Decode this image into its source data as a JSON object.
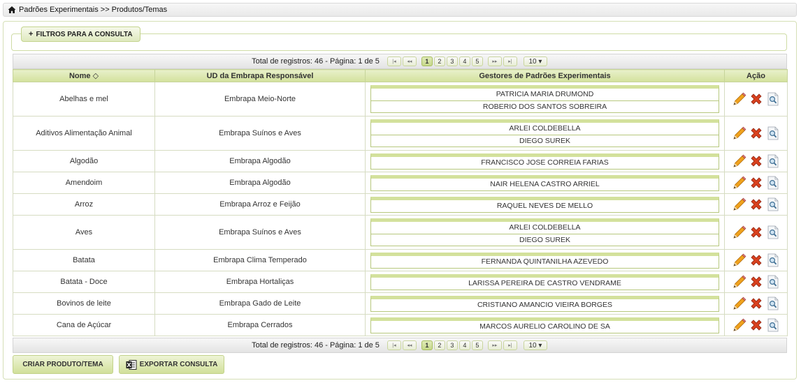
{
  "breadcrumb": {
    "home_icon": "home-icon",
    "text": "Padrões Experimentais >> Produtos/Temas"
  },
  "filters": {
    "toggle_label": "FILTROS PARA A CONSULTA",
    "toggle_symbol": "+"
  },
  "pagination": {
    "info": "Total de registros: 46 - Página: 1 de 5",
    "first": "|◂",
    "prev": "◂◂",
    "pages": [
      "1",
      "2",
      "3",
      "4",
      "5"
    ],
    "current_page": "1",
    "next": "▸▸",
    "last": "▸|",
    "page_size": "10 ▾"
  },
  "table": {
    "columns": [
      "Nome ◇",
      "UD da Embrapa Responsável",
      "Gestores de Padrões Experimentais",
      "Ação"
    ],
    "rows": [
      {
        "nome": "Abelhas e mel",
        "ud": "Embrapa Meio-Norte",
        "gestores": [
          "PATRICIA MARIA DRUMOND",
          "ROBERIO DOS SANTOS SOBREIRA"
        ]
      },
      {
        "nome": "Aditivos Alimentação Animal",
        "ud": "Embrapa Suínos e Aves",
        "gestores": [
          "ARLEI COLDEBELLA",
          "DIEGO SUREK"
        ]
      },
      {
        "nome": "Algodão",
        "ud": "Embrapa Algodão",
        "gestores": [
          "FRANCISCO JOSE CORREIA FARIAS"
        ]
      },
      {
        "nome": "Amendoim",
        "ud": "Embrapa Algodão",
        "gestores": [
          "NAIR HELENA CASTRO ARRIEL"
        ]
      },
      {
        "nome": "Arroz",
        "ud": "Embrapa Arroz e Feijão",
        "gestores": [
          "RAQUEL NEVES DE MELLO"
        ]
      },
      {
        "nome": "Aves",
        "ud": "Embrapa Suínos e Aves",
        "gestores": [
          "ARLEI COLDEBELLA",
          "DIEGO SUREK"
        ]
      },
      {
        "nome": "Batata",
        "ud": "Embrapa Clima Temperado",
        "gestores": [
          "FERNANDA QUINTANILHA AZEVEDO"
        ]
      },
      {
        "nome": "Batata - Doce",
        "ud": "Embrapa Hortaliças",
        "gestores": [
          "LARISSA PEREIRA DE CASTRO VENDRAME"
        ]
      },
      {
        "nome": "Bovinos de leite",
        "ud": "Embrapa Gado de Leite",
        "gestores": [
          "CRISTIANO AMANCIO VIEIRA BORGES"
        ]
      },
      {
        "nome": "Cana de Açúcar",
        "ud": "Embrapa Cerrados",
        "gestores": [
          "MARCOS AURELIO CAROLINO DE SA"
        ]
      }
    ],
    "action_icons": [
      "pencil-icon",
      "delete-x-icon",
      "magnifier-icon"
    ]
  },
  "buttons": {
    "create": "CRIAR PRODUTO/TEMA",
    "export": "EXPORTAR CONSULTA",
    "export_icon": "excel-icon"
  },
  "colors": {
    "header_green": "#d3e19c",
    "border_green": "#c6d49a",
    "delete_red": "#d9411e",
    "pencil_orange": "#f0a21d"
  }
}
